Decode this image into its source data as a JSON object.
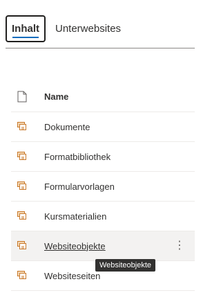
{
  "tabs": {
    "active_label": "Inhalt",
    "other_label": "Unterwebsites"
  },
  "list": {
    "header": "Name",
    "items": [
      {
        "label": "Dokumente",
        "icon": "library-icon"
      },
      {
        "label": "Formatbibliothek",
        "icon": "library-icon"
      },
      {
        "label": "Formularvorlagen",
        "icon": "library-icon"
      },
      {
        "label": "Kursmaterialien",
        "icon": "library-icon"
      },
      {
        "label": "Websiteobjekte",
        "icon": "library-icon",
        "hovered": true
      },
      {
        "label": "Websiteseiten",
        "icon": "library-icon"
      }
    ],
    "more_glyph": "⋮"
  },
  "tooltip": {
    "text": "Websiteobjekte"
  },
  "colors": {
    "accent": "#0f6cbd",
    "library_icon": "#c8782a",
    "hover_row": "#f3f2f1"
  }
}
